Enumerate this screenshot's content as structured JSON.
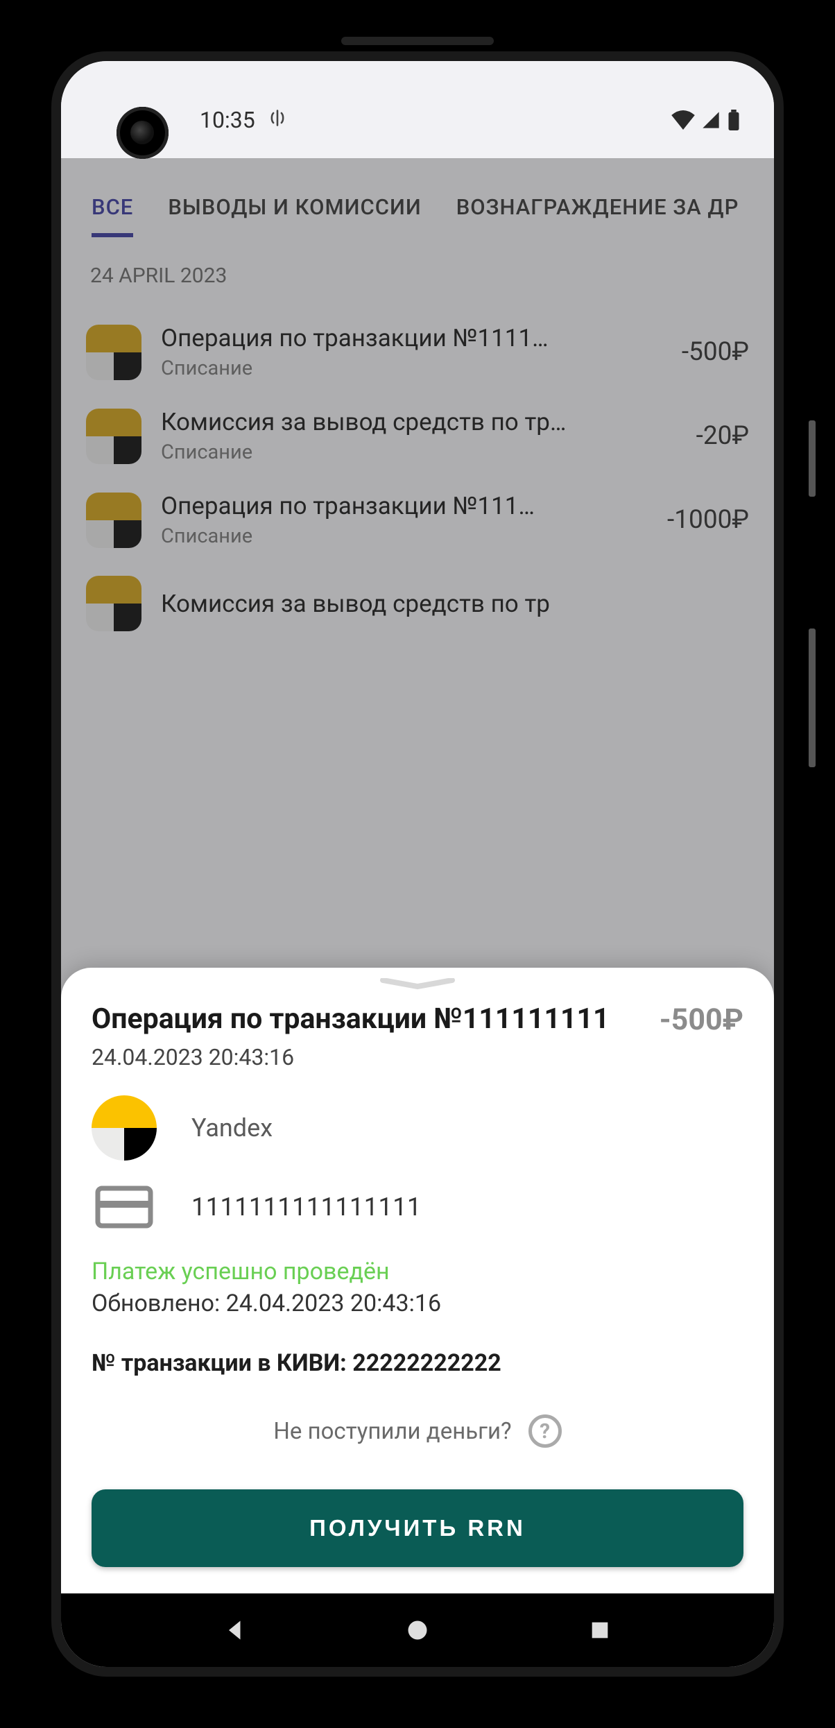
{
  "statusbar": {
    "time": "10:35"
  },
  "tabs": {
    "all": "ВСЕ",
    "withdrawals": "ВЫВОДЫ И КОМИССИИ",
    "rewards": "ВОЗНАГРАЖДЕНИЕ ЗА ДР"
  },
  "list": {
    "date_header": "24 APRIL 2023",
    "items": [
      {
        "title": "Операция по транзакции №1111…",
        "sub": "Списание",
        "amount": "-500₽"
      },
      {
        "title": "Комиссия за вывод средств по тр…",
        "sub": "Списание",
        "amount": "-20₽"
      },
      {
        "title": "Операция по транзакции №111…",
        "sub": "Списание",
        "amount": "-1000₽"
      },
      {
        "title": "Комиссия за вывод средств по тр",
        "sub": "",
        "amount": ""
      }
    ]
  },
  "sheet": {
    "title": "Операция по транзакции №111111111",
    "amount": "-500₽",
    "date": "24.04.2023 20:43:16",
    "merchant": "Yandex",
    "card": "1111111111111111",
    "status": "Платеж успешно проведён",
    "updated": "Обновлено: 24.04.2023 20:43:16",
    "qiwi": "№ транзакции в КИВИ: 22222222222",
    "help": "Не поступили деньги?",
    "button": "ПОЛУЧИТЬ RRN"
  }
}
